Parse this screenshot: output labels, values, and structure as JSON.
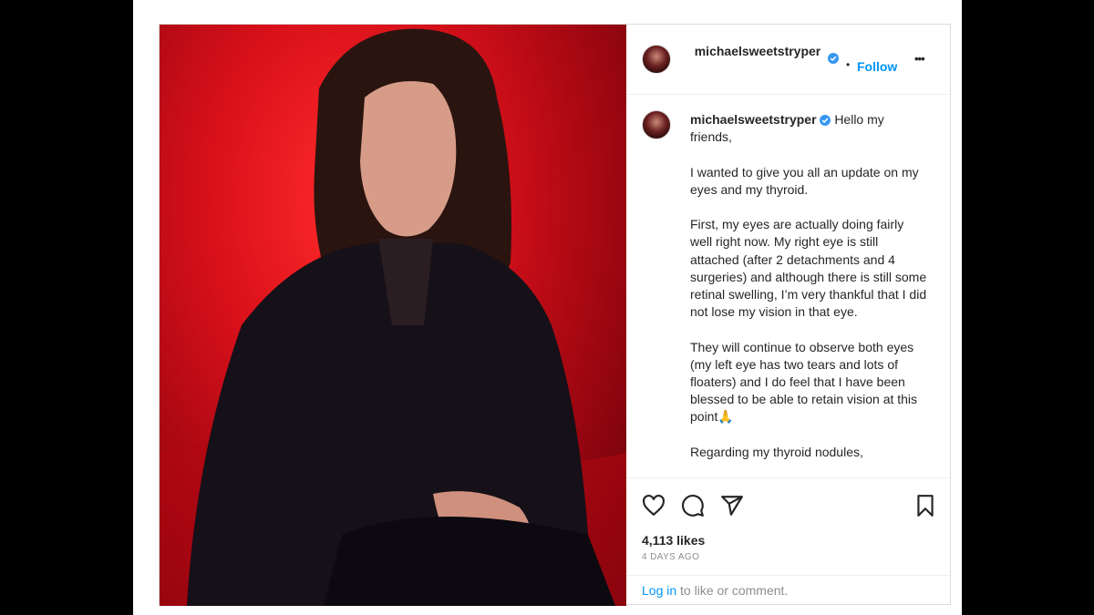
{
  "post": {
    "username": "michaelsweetstryper",
    "follow_label": "Follow",
    "more_label": "•••",
    "caption_intro": "Hello my friends,",
    "caption_body": "I wanted to give you all an update on my eyes and my thyroid.\n\nFirst, my eyes are actually doing fairly well right now. My right eye is still attached (after 2 detachments and 4 surgeries) and although there is still some retinal swelling, I’m very thankful that I did not lose my vision in that eye.\n\nThey will continue to observe both eyes (my left eye has two tears and lots of floaters) and I do feel that I have been blessed to be able to retain vision at this point🙏\n\nRegarding my thyroid nodules,",
    "likes": "4,113 likes",
    "date": "4 DAYS AGO",
    "login_link": "Log in",
    "login_rest": " to like or comment."
  },
  "icons": {
    "like": "heart-icon",
    "comment": "comment-icon",
    "share": "share-icon",
    "save": "bookmark-icon",
    "verified": "verified-badge-icon"
  },
  "colors": {
    "accent": "#0095f6",
    "verified": "#3897f0",
    "text": "#262626",
    "muted": "#8e8e8e"
  }
}
